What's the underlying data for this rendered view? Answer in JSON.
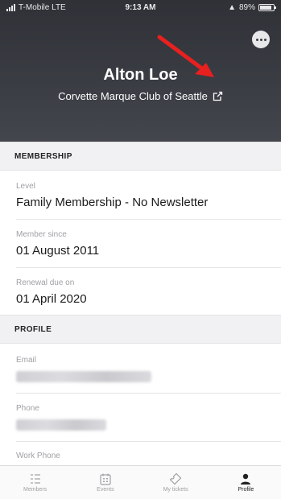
{
  "status_bar": {
    "carrier": "T-Mobile LTE",
    "time": "9:13 AM",
    "battery": "89%",
    "battery_level": 0.89
  },
  "profile": {
    "name": "Alton Loe",
    "club": "Corvette Marque Club of Seattle"
  },
  "sections": {
    "membership_title": "MEMBERSHIP",
    "profile_title": "PROFILE"
  },
  "membership": {
    "level_label": "Level",
    "level_value": "Family Membership - No Newsletter",
    "since_label": "Member since",
    "since_value": "01 August 2011",
    "renewal_label": "Renewal due on",
    "renewal_value": "01 April 2020"
  },
  "profile_fields": {
    "email_label": "Email",
    "phone_label": "Phone",
    "work_phone_label": "Work Phone"
  },
  "tabs": [
    {
      "label": "Members",
      "icon": "members-list-icon",
      "active": false
    },
    {
      "label": "Events",
      "icon": "calendar-icon",
      "active": false
    },
    {
      "label": "My tickets",
      "icon": "ticket-icon",
      "active": false
    },
    {
      "label": "Profile",
      "icon": "person-icon",
      "active": true
    }
  ],
  "colors": {
    "header_bg": "#3b3d44",
    "arrow": "#e8201f",
    "section_bg": "#f1f1f3"
  }
}
